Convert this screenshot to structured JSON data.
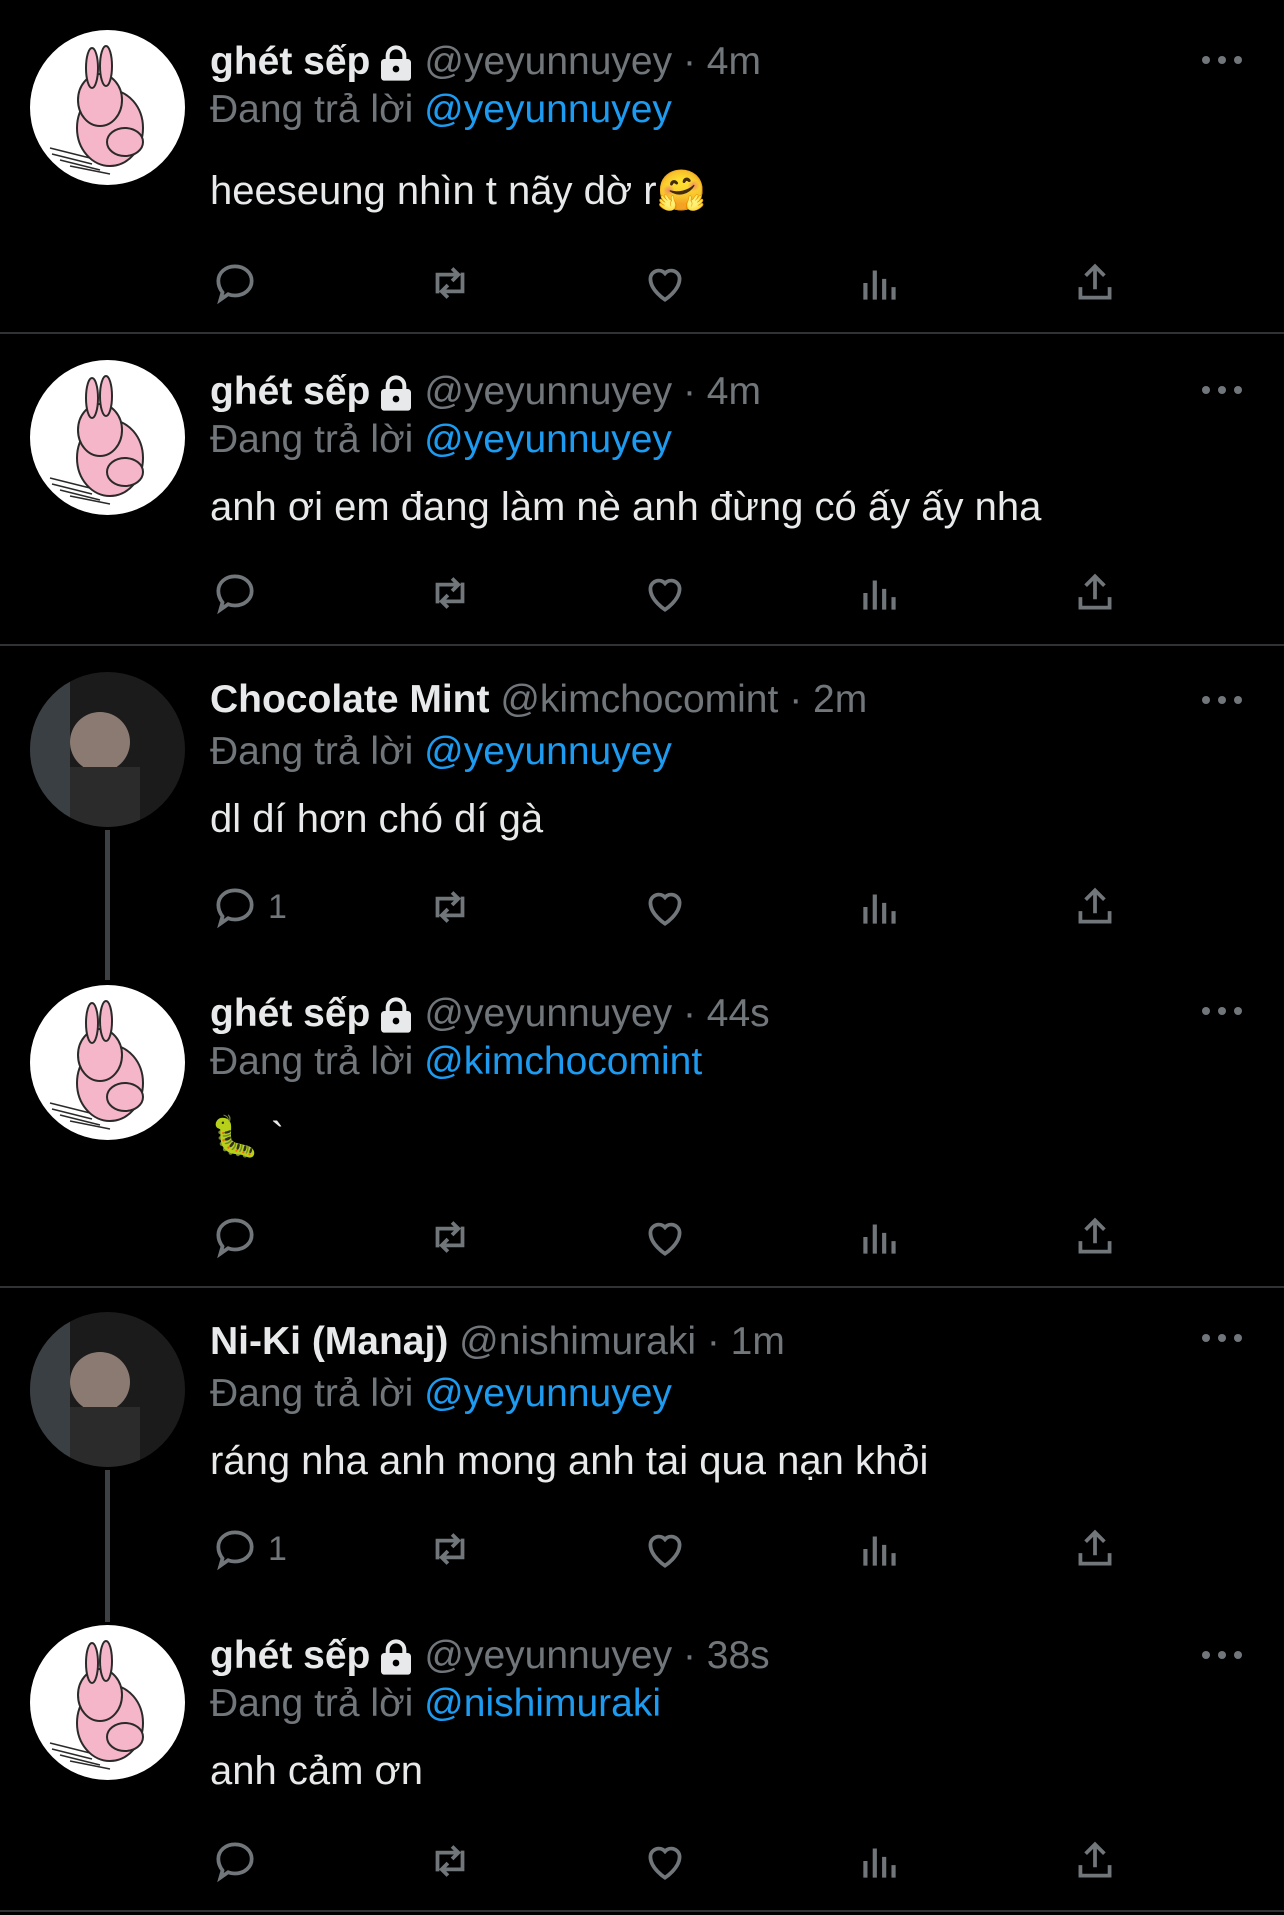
{
  "colors": {
    "background": "#000000",
    "text": "#e7e9ea",
    "muted": "#71767b",
    "link": "#1d9bf0",
    "divider": "#2f3336"
  },
  "tweets": [
    {
      "name": "ghét sếp",
      "locked": true,
      "handle": "@yeyunnuyey",
      "time": "· 4m",
      "replying_label": "Đang trả lời",
      "replying_to": "@yeyunnuyey",
      "text": "heeseung nhìn t nãy dờ r🤗",
      "reply_count": "",
      "avatar": "pink-rabbit-avatar"
    },
    {
      "name": "ghét sếp",
      "locked": true,
      "handle": "@yeyunnuyey",
      "time": "· 4m",
      "replying_label": "Đang trả lời",
      "replying_to": "@yeyunnuyey",
      "text": "anh ơi em đang làm nè anh đừng có ấy ấy nha",
      "reply_count": "",
      "avatar": "pink-rabbit-avatar"
    },
    {
      "name": "Chocolate Mint",
      "locked": false,
      "handle": "@kimchocomint",
      "time": "· 2m",
      "replying_label": "Đang trả lời",
      "replying_to": "@yeyunnuyey",
      "text": "dl dí hơn chó dí gà",
      "reply_count": "1",
      "avatar": "photo-avatar"
    },
    {
      "name": "ghét sếp",
      "locked": true,
      "handle": "@yeyunnuyey",
      "time": "· 44s",
      "replying_label": "Đang trả lời",
      "replying_to": "@kimchocomint",
      "text": "🐛 `",
      "reply_count": "",
      "avatar": "pink-rabbit-avatar"
    },
    {
      "name": "Ni-Ki (Manaj)",
      "locked": false,
      "handle": "@nishimuraki",
      "time": "· 1m",
      "replying_label": "Đang trả lời",
      "replying_to": "@yeyunnuyey",
      "text": "ráng nha anh mong anh tai qua nạn khỏi",
      "reply_count": "1",
      "avatar": "photo-avatar"
    },
    {
      "name": "ghét sếp",
      "locked": true,
      "handle": "@yeyunnuyey",
      "time": "· 38s",
      "replying_label": "Đang trả lời",
      "replying_to": "@nishimuraki",
      "text": "anh cảm ơn",
      "reply_count": "",
      "avatar": "pink-rabbit-avatar"
    }
  ]
}
